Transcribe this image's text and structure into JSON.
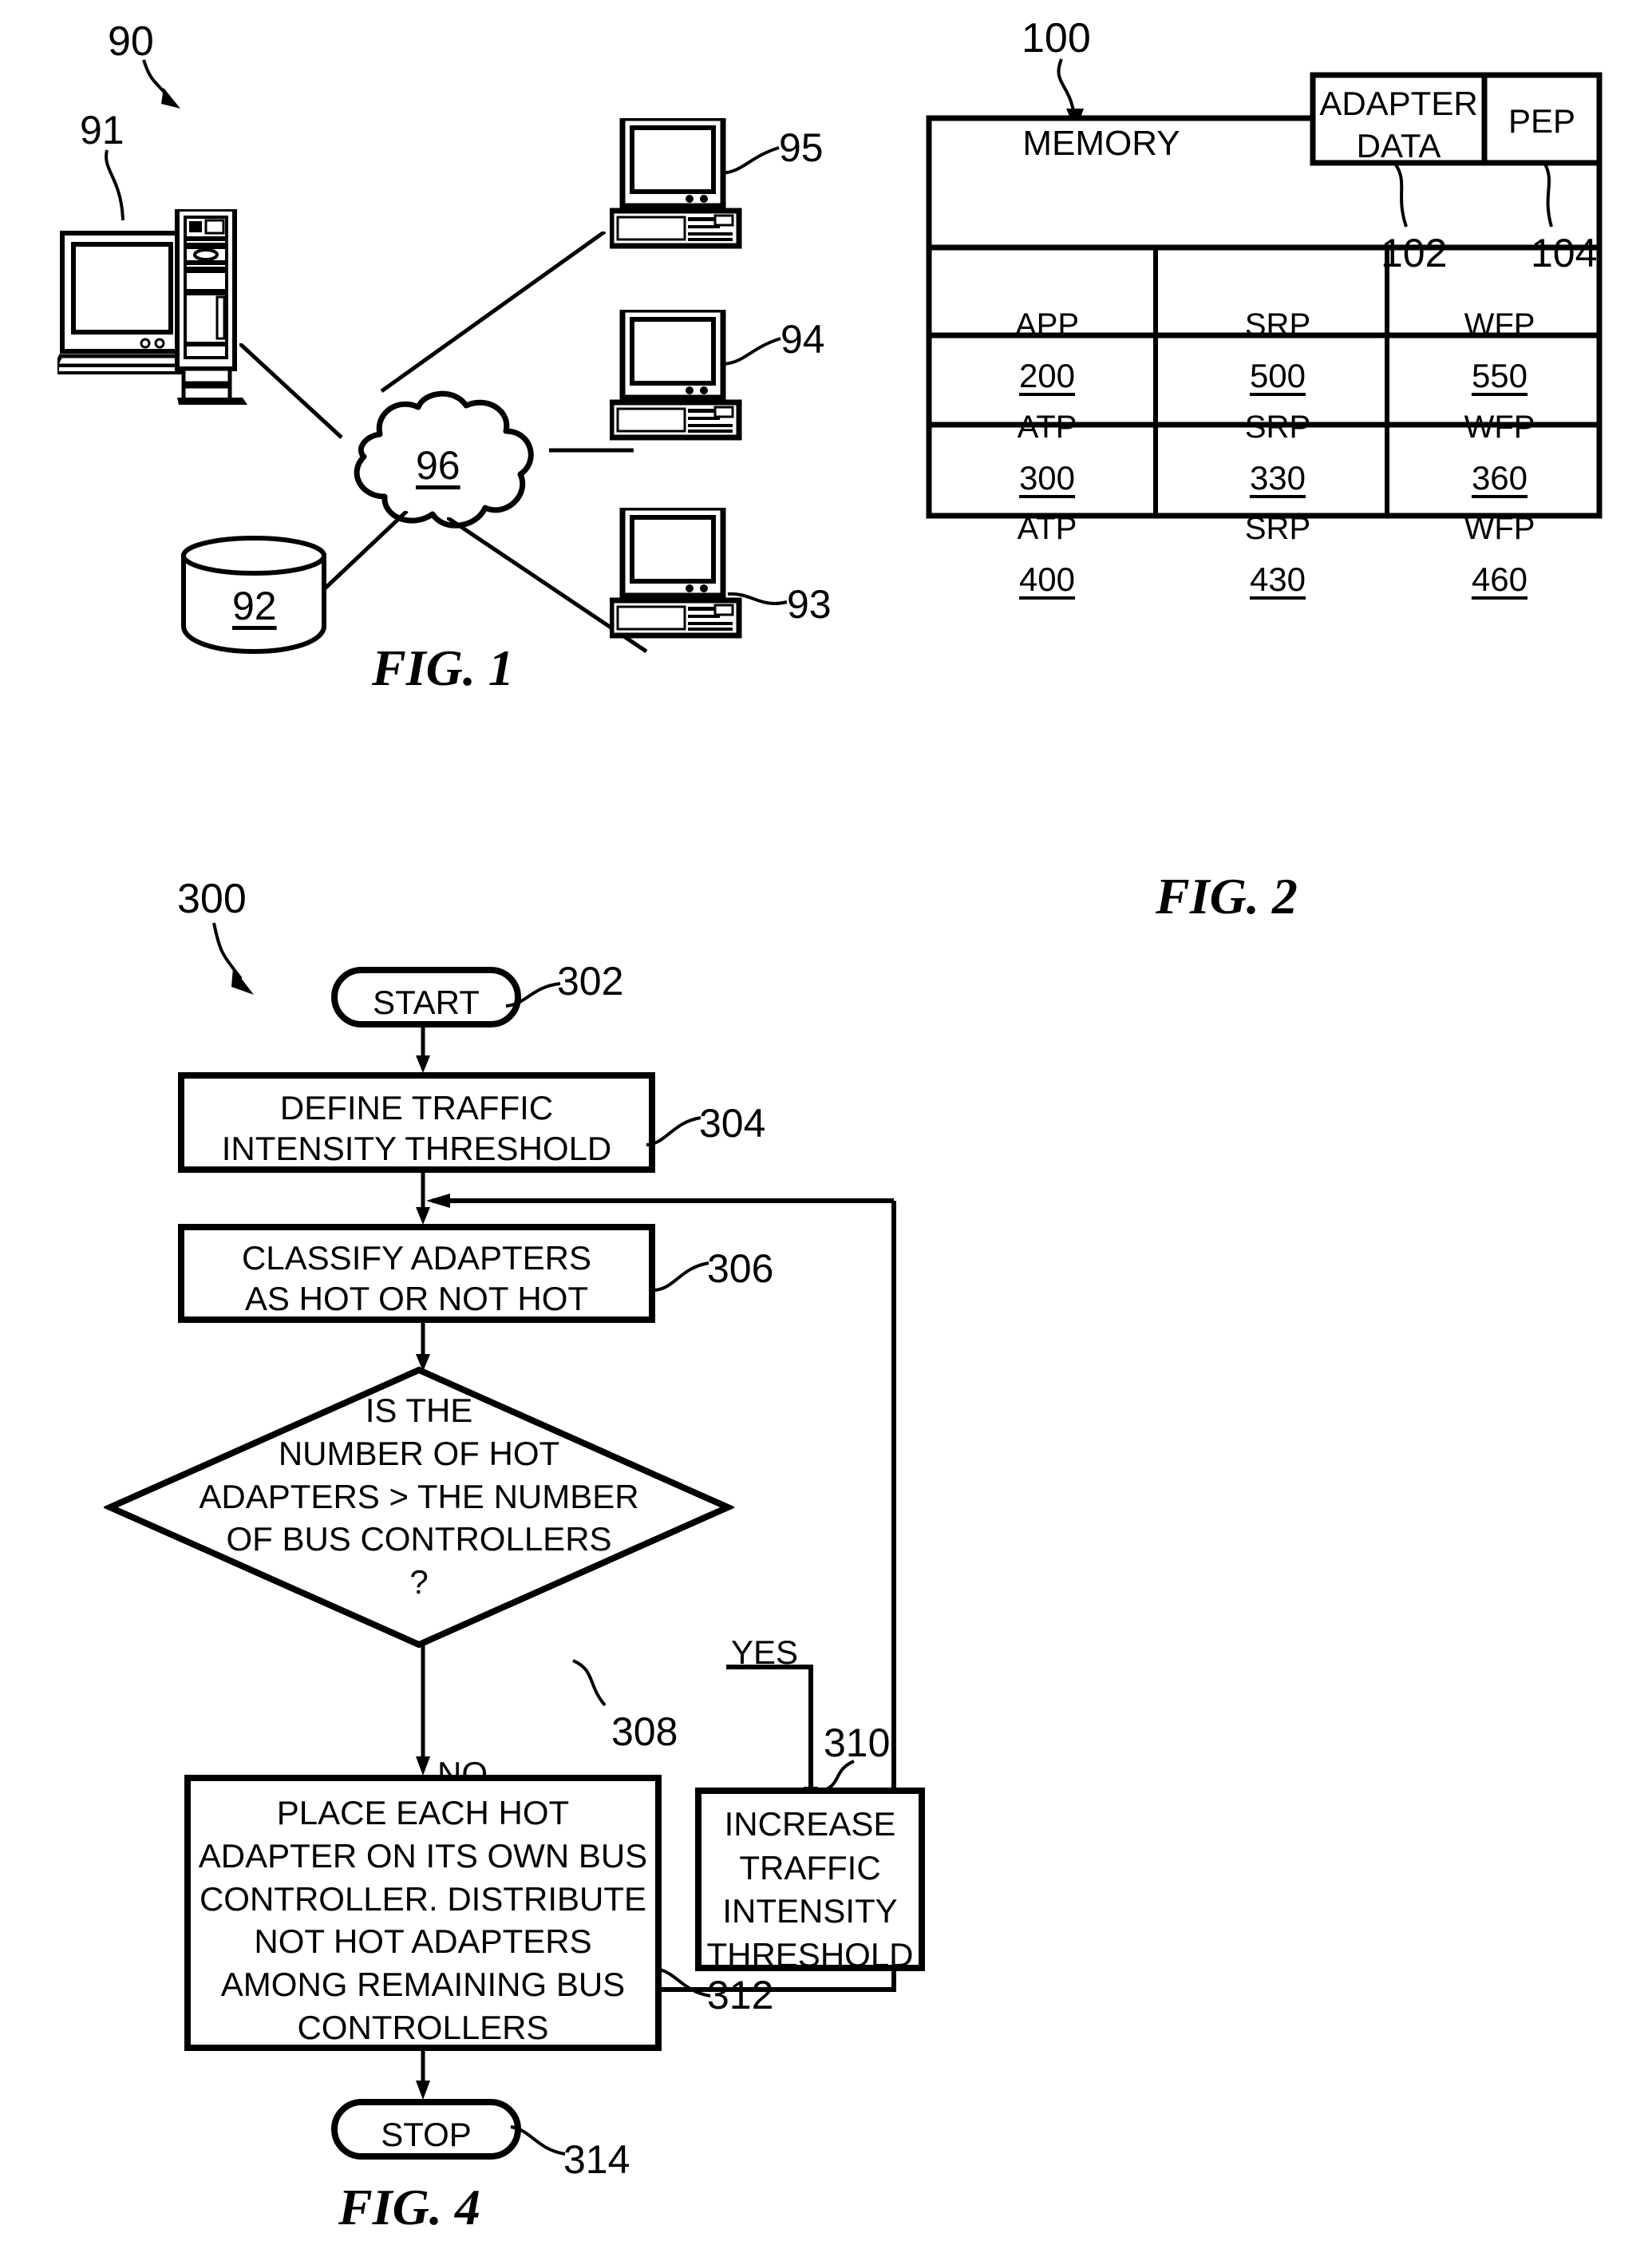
{
  "figures": {
    "fig1": {
      "caption": "FIG. 1",
      "system_ref": "90",
      "nodes": [
        {
          "ref": "91",
          "type": "workstation-monitor-tower",
          "name": "server-workstation"
        },
        {
          "ref": "92",
          "type": "database-cylinder",
          "name": "database-storage",
          "inner_label": "92"
        },
        {
          "ref": "93",
          "type": "desktop-computer",
          "name": "client-computer-93"
        },
        {
          "ref": "94",
          "type": "desktop-computer",
          "name": "client-computer-94"
        },
        {
          "ref": "95",
          "type": "desktop-computer",
          "name": "client-computer-95"
        },
        {
          "ref": "96",
          "type": "network-cloud",
          "name": "network-cloud",
          "inner_label": "96"
        }
      ]
    },
    "fig2": {
      "caption": "FIG. 2",
      "system_ref": "100",
      "memory_label": "MEMORY",
      "header_cells": [
        {
          "label": "ADAPTER\nDATA",
          "ref": "102"
        },
        {
          "label": "PEP",
          "ref": "104"
        }
      ],
      "table_rows": [
        [
          {
            "label": "APP",
            "value": "200"
          },
          {
            "label": "SRP",
            "value": "500"
          },
          {
            "label": "WFP",
            "value": "550"
          }
        ],
        [
          {
            "label": "ATP",
            "value": "300"
          },
          {
            "label": "SRP",
            "value": "330"
          },
          {
            "label": "WFP",
            "value": "360"
          }
        ],
        [
          {
            "label": "ATP",
            "value": "400"
          },
          {
            "label": "SRP",
            "value": "430"
          },
          {
            "label": "WFP",
            "value": "460"
          }
        ]
      ]
    },
    "fig4": {
      "caption": "FIG. 4",
      "flow_ref": "300",
      "steps": [
        {
          "ref": "302",
          "shape": "terminator",
          "text": "START"
        },
        {
          "ref": "304",
          "shape": "process",
          "text": "DEFINE TRAFFIC\nINTENSITY THRESHOLD"
        },
        {
          "ref": "306",
          "shape": "process",
          "text": "CLASSIFY ADAPTERS\nAS HOT OR NOT HOT"
        },
        {
          "ref": "308",
          "shape": "decision",
          "text": "IS THE\nNUMBER OF HOT\nADAPTERS > THE NUMBER\nOF BUS CONTROLLERS\n?"
        },
        {
          "ref": "310",
          "shape": "process",
          "text": "INCREASE\nTRAFFIC\nINTENSITY\nTHRESHOLD"
        },
        {
          "ref": "312",
          "shape": "process",
          "text": "PLACE EACH HOT\nADAPTER ON ITS OWN BUS\nCONTROLLER. DISTRIBUTE\nNOT HOT ADAPTERS\nAMONG REMAINING BUS\nCONTROLLERS"
        },
        {
          "ref": "314",
          "shape": "terminator",
          "text": "STOP"
        }
      ],
      "branch_labels": {
        "yes": "YES",
        "no": "NO"
      }
    }
  },
  "colors": {
    "ink": "#000000",
    "paper": "#ffffff"
  }
}
